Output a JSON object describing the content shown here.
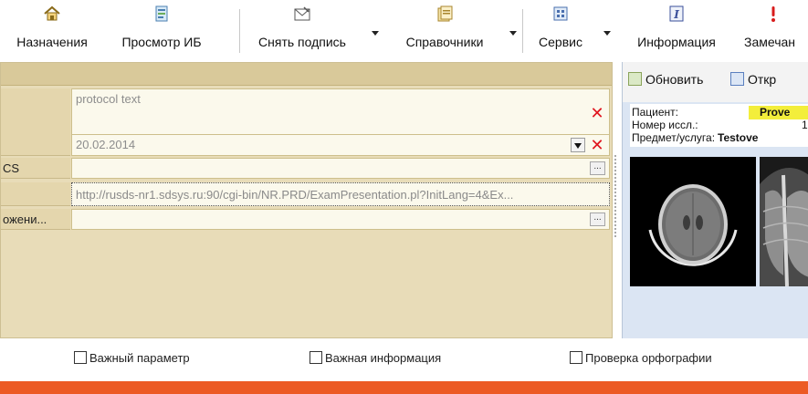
{
  "toolbar": {
    "items": [
      {
        "label": "Назначения",
        "icon": "home-icon"
      },
      {
        "label": "Просмотр ИБ",
        "icon": "record-view-icon"
      },
      {
        "label": "Снять подпись",
        "icon": "envelope-sign-icon"
      },
      {
        "label": "Справочники",
        "icon": "dictionary-icon"
      },
      {
        "label": "Сервис",
        "icon": "service-icon"
      },
      {
        "label": "Информация",
        "icon": "info-icon"
      },
      {
        "label": "Замечан",
        "icon": "exclamation-icon"
      }
    ]
  },
  "form": {
    "rows": [
      {
        "label": "",
        "value": "protocol text"
      },
      {
        "label": "",
        "value": "20.02.2014"
      },
      {
        "label": "CS",
        "value": ""
      },
      {
        "label": "",
        "value": "http://rusds-nr1.sdsys.ru:90/cgi-bin/NR.PRD/ExamPresentation.pl?InitLang=4&Ex..."
      },
      {
        "label": "ожени...",
        "value": ""
      }
    ],
    "ellipsis": "..."
  },
  "viewer": {
    "refresh_label": "Обновить",
    "open_label": "Откр",
    "patient_key": "Пациент:",
    "patient_value": "Prove",
    "exam_no_key": "Номер иссл.:",
    "exam_no_value": "1",
    "subject_key": "Предмет/услуга:",
    "subject_value": "Testove"
  },
  "options": {
    "important_param": "Важный параметр",
    "important_info": "Важная информация",
    "spellcheck": "Проверка орфографии"
  },
  "colors": {
    "form_bg": "#e8dcb8",
    "accent_bar": "#ec5a24",
    "highlight": "#f3ee3b",
    "delete_red": "#e0141e"
  }
}
